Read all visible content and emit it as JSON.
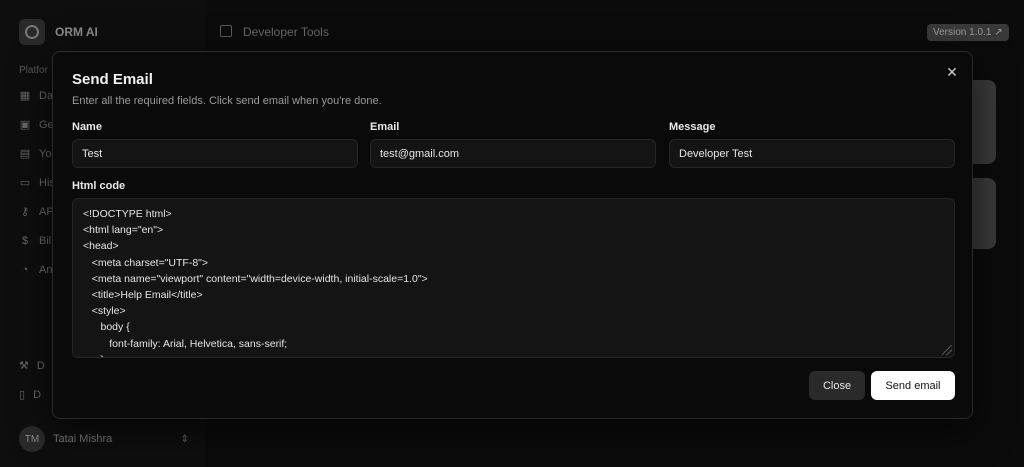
{
  "app": {
    "name": "ORM AI",
    "section_label": "Platfor",
    "nav_items": [
      {
        "label": "Da",
        "icon": "grid-icon"
      },
      {
        "label": "Ge",
        "icon": "image-icon"
      },
      {
        "label": "Yo",
        "icon": "images-icon"
      },
      {
        "label": "His",
        "icon": "history-icon"
      },
      {
        "label": "AP",
        "icon": "key-icon"
      },
      {
        "label": "Bil",
        "icon": "dollar-icon"
      },
      {
        "label": "An",
        "icon": "pie-chart-icon"
      }
    ],
    "bottom_items": [
      {
        "label": "D",
        "icon": "tool-icon"
      },
      {
        "label": "D",
        "icon": "book-icon"
      }
    ],
    "user": {
      "initials": "TM",
      "name": "Tatai Mishra"
    },
    "topbar_title": "Developer Tools",
    "version": "Version 1.0.1"
  },
  "modal": {
    "title": "Send Email",
    "description": "Enter all the required fields. Click send email when you're done.",
    "name_label": "Name",
    "name_value": "Test",
    "email_label": "Email",
    "email_value": "test@gmail.com",
    "message_label": "Message",
    "message_value": "Developer Test",
    "html_label": "Html code",
    "html_value": "<!DOCTYPE html>\n<html lang=\"en\">\n<head>\n   <meta charset=\"UTF-8\">\n   <meta name=\"viewport\" content=\"width=device-width, initial-scale=1.0\">\n   <title>Help Email</title>\n   <style>\n      body {\n         font-family: Arial, Helvetica, sans-serif;\n      }",
    "close_label": "Close",
    "send_label": "Send email"
  }
}
